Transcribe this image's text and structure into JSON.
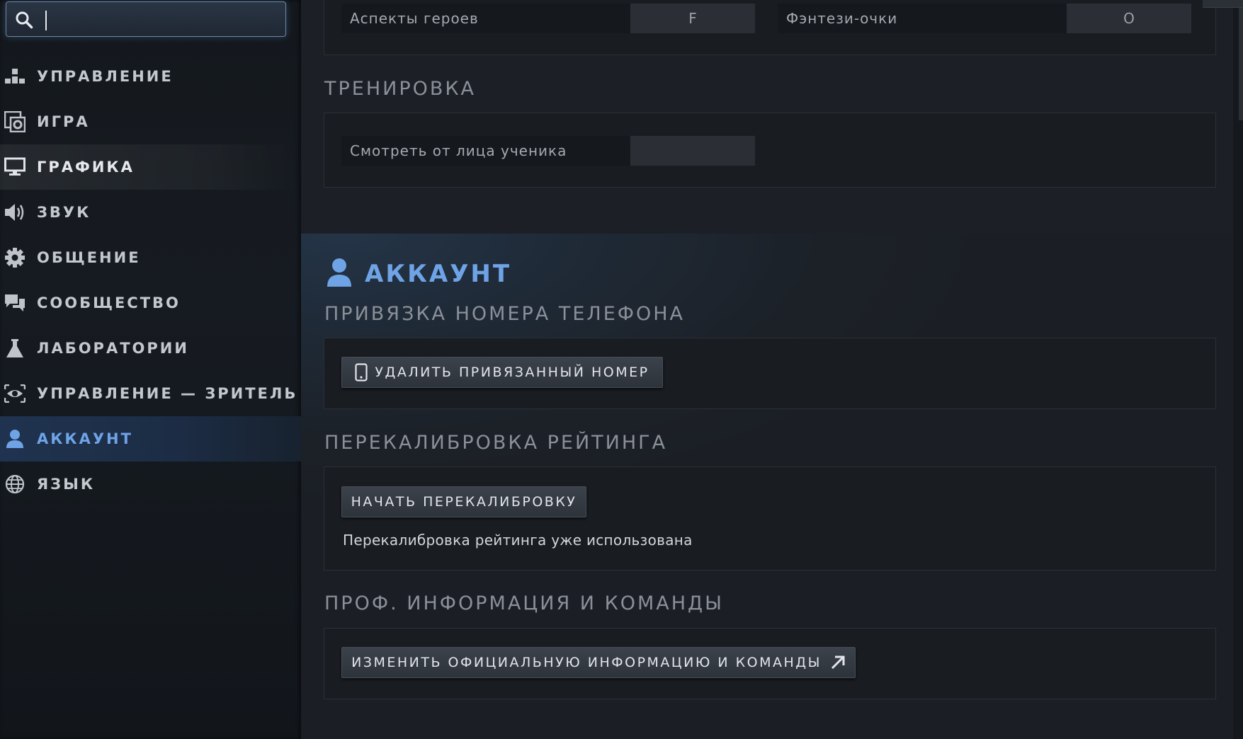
{
  "search": {
    "value": "",
    "placeholder": ""
  },
  "sidebar": {
    "items": [
      {
        "label": "УПРАВЛЕНИЕ",
        "icon": "hierarchy-icon",
        "state": "normal"
      },
      {
        "label": "ИГРА",
        "icon": "game-settings-icon",
        "state": "normal"
      },
      {
        "label": "ГРАФИКА",
        "icon": "monitor-icon",
        "state": "hover"
      },
      {
        "label": "ЗВУК",
        "icon": "speaker-icon",
        "state": "normal"
      },
      {
        "label": "ОБЩЕНИЕ",
        "icon": "gear-icon",
        "state": "normal"
      },
      {
        "label": "СООБЩЕСТВО",
        "icon": "chat-icon",
        "state": "normal"
      },
      {
        "label": "ЛАБОРАТОРИИ",
        "icon": "flask-icon",
        "state": "normal"
      },
      {
        "label": "УПРАВЛЕНИЕ — ЗРИТЕЛЬ",
        "icon": "eye-icon",
        "state": "normal"
      },
      {
        "label": "АККАУНТ",
        "icon": "user-icon",
        "state": "active"
      },
      {
        "label": "ЯЗЫК",
        "icon": "globe-icon",
        "state": "normal"
      }
    ]
  },
  "top_panel": {
    "left_field": {
      "label": "Аспекты героев",
      "key": "F"
    },
    "right_field": {
      "label": "Фэнтези-очки",
      "key": "O"
    }
  },
  "training": {
    "title": "ТРЕНИРОВКА",
    "field": {
      "label": "Смотреть от лица ученика",
      "key": ""
    }
  },
  "account": {
    "title": "АККАУНТ",
    "phone": {
      "title": "ПРИВЯЗКА НОМЕРА ТЕЛЕФОНА",
      "button": "УДАЛИТЬ ПРИВЯЗАННЫЙ НОМЕР"
    },
    "recalibration": {
      "title": "ПЕРЕКАЛИБРОВКА РЕЙТИНГА",
      "button": "НАЧАТЬ ПЕРЕКАЛИБРОВКУ",
      "note": "Перекалибровка рейтинга уже использована"
    },
    "pro": {
      "title": "ПРОФ. ИНФОРМАЦИЯ И КОМАНДЫ",
      "button": "ИЗМЕНИТЬ ОФИЦИАЛЬНУЮ ИНФОРМАЦИЮ И КОМАНДЫ"
    }
  },
  "colors": {
    "accent": "#6ea3e6",
    "sidebar_bg": "#14181d",
    "main_bg": "#1c2026",
    "panel_bg": "#191c21"
  }
}
